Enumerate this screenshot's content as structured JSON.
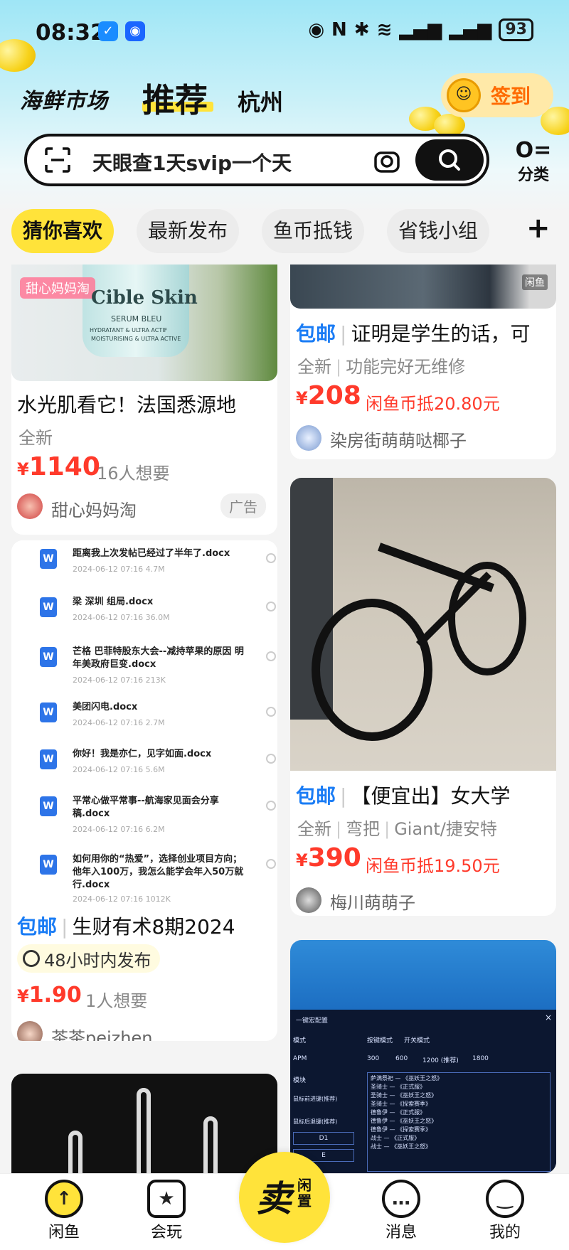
{
  "status_bar": {
    "time": "08:32",
    "battery": "93"
  },
  "header": {
    "brand": "海鲜市场",
    "tab_recommend": "推荐",
    "city": "杭州",
    "checkin_label": "签到"
  },
  "search": {
    "query": "天眼查1天svip一个天",
    "categories_label": "分类"
  },
  "tabs": [
    "猜你喜欢",
    "最新发布",
    "鱼币抵钱",
    "省钱小组"
  ],
  "feed": {
    "left": [
      {
        "image_text": {
          "shop_tag": "甜心妈妈淘",
          "brand": "Cible Skin",
          "line1": "SERUM BLEU",
          "line2": "HYDRATANT & ULTRA ACTIF",
          "line3": "MOISTURISING & ULTRA ACTIVE"
        },
        "title": "水光肌看它！法国悉源地",
        "condition": "全新",
        "price": "1140",
        "wants": "16人想要",
        "seller": "甜心妈妈淘",
        "ad": "广告"
      },
      {
        "docs": [
          {
            "name": "距离我上次发帖已经过了半年了.docx",
            "meta": "2024-06-12 07:16   4.7M"
          },
          {
            "name": "梁 深圳 组局.docx",
            "meta": "2024-06-12 07:16   36.0M"
          },
          {
            "name": "芒格 巴菲特股东大会--减持苹果的原因 明年美政府巨变.docx",
            "meta": "2024-06-12 07:16   213K"
          },
          {
            "name": "美团闪电.docx",
            "meta": "2024-06-12 07:16   2.7M"
          },
          {
            "name": "你好！我是亦仁，见字如面.docx",
            "meta": "2024-06-12 07:16   5.6M"
          },
          {
            "name": "平常心做平常事--航海家见面会分享稿.docx",
            "meta": "2024-06-12 07:16   6.2M"
          },
          {
            "name": "如何用你的“热爱”，选择创业项目方向；他年入100万，我怎么能学会年入50万就行.docx",
            "meta": "2024-06-12 07:16   1012K"
          }
        ],
        "shipping": "包邮",
        "title": "生财有术8期2024",
        "time_badge": "48小时内发布",
        "price": "1.90",
        "wants": "1人想要",
        "seller": "茶茶peizhen"
      }
    ],
    "right": [
      {
        "shipping": "包邮",
        "title": "证明是学生的话，可",
        "condition": "全新",
        "condition2": "功能完好无维修",
        "price": "208",
        "coin": "闲鱼币抵20.80元",
        "seller": "染房街萌萌哒椰子",
        "image_tag": "闲鱼"
      },
      {
        "shipping": "包邮",
        "title": "【便宜出】女大学",
        "condition": "全新",
        "condition2": "弯把",
        "condition3": "Giant/捷安特",
        "price": "390",
        "coin": "闲鱼币抵19.50元",
        "seller": "梅川萌萌子"
      },
      {
        "screen_text": {
          "title": "一键宏配置",
          "mode": "模式",
          "mode_opt1": "按键模式",
          "mode_opt2": "开关模式",
          "apm": "APM",
          "apm_opts": [
            "300",
            "600",
            "1200 (推荐)",
            "1800"
          ],
          "module": "模块",
          "list": [
            "萨满祭祀 — 《巫妖王之怒》",
            "圣骑士 — 《正式服》",
            "圣骑士 — 《巫妖王之怒》",
            "圣骑士 — 《探索赛季》",
            "德鲁伊 — 《正式服》",
            "德鲁伊 — 《巫妖王之怒》",
            "德鲁伊 — 《探索赛季》",
            "战士 — 《正式服》",
            "战士 — 《巫妖王之怒》"
          ],
          "k1": "鼠标前进键(推荐)",
          "k2": "鼠标后退键(推荐)",
          "d1": "D1",
          "e": "E"
        }
      }
    ]
  },
  "bottom_nav": {
    "home": "闲鱼",
    "play": "会玩",
    "sell_main": "卖",
    "sell_sub": "闲置",
    "messages": "消息",
    "mine": "我的"
  },
  "colors": {
    "accent_yellow": "#ffe33a",
    "price_red": "#ff3a2b",
    "shipping_blue": "#1a7cf5"
  }
}
